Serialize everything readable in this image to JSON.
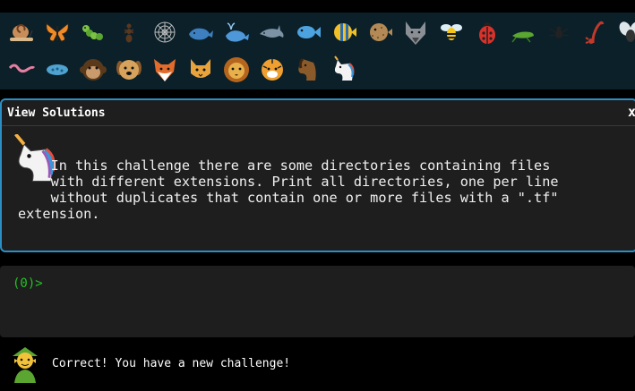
{
  "tray": {
    "row1": [
      "snail-icon",
      "butterfly-icon",
      "caterpillar-icon",
      "ant-icon",
      "spider-web-icon",
      "whale-icon",
      "spouting-whale-icon",
      "dolphin-icon",
      "fish-icon",
      "tropical-fish-icon",
      "blowfish-icon",
      "wolf-icon",
      "bee-icon",
      "ladybug-icon",
      "cricket-icon",
      "spider-icon",
      "scorpion-icon",
      "fly-icon"
    ],
    "row2": [
      "worm-icon",
      "microbe-icon",
      "monkey-face-icon",
      "dog-face-icon",
      "fox-face-icon",
      "cat-face-icon",
      "lion-face-icon",
      "tiger-face-icon",
      "horse-face-icon",
      "unicorn-icon"
    ]
  },
  "modal": {
    "title": "View Solutions",
    "close": "x",
    "description_lines": [
      "    In this challenge there are some directories containing files",
      "    with different extensions. Print all directories, one per line",
      "    without duplicates that contain one or more files with a \".tf\"",
      "extension."
    ],
    "accent": "#2b8fc6"
  },
  "terminal": {
    "prompt": "(0)>",
    "prompt_color": "#22c322"
  },
  "status": {
    "message": "Correct! You have a new challenge!",
    "avatar": "elf-icon"
  }
}
